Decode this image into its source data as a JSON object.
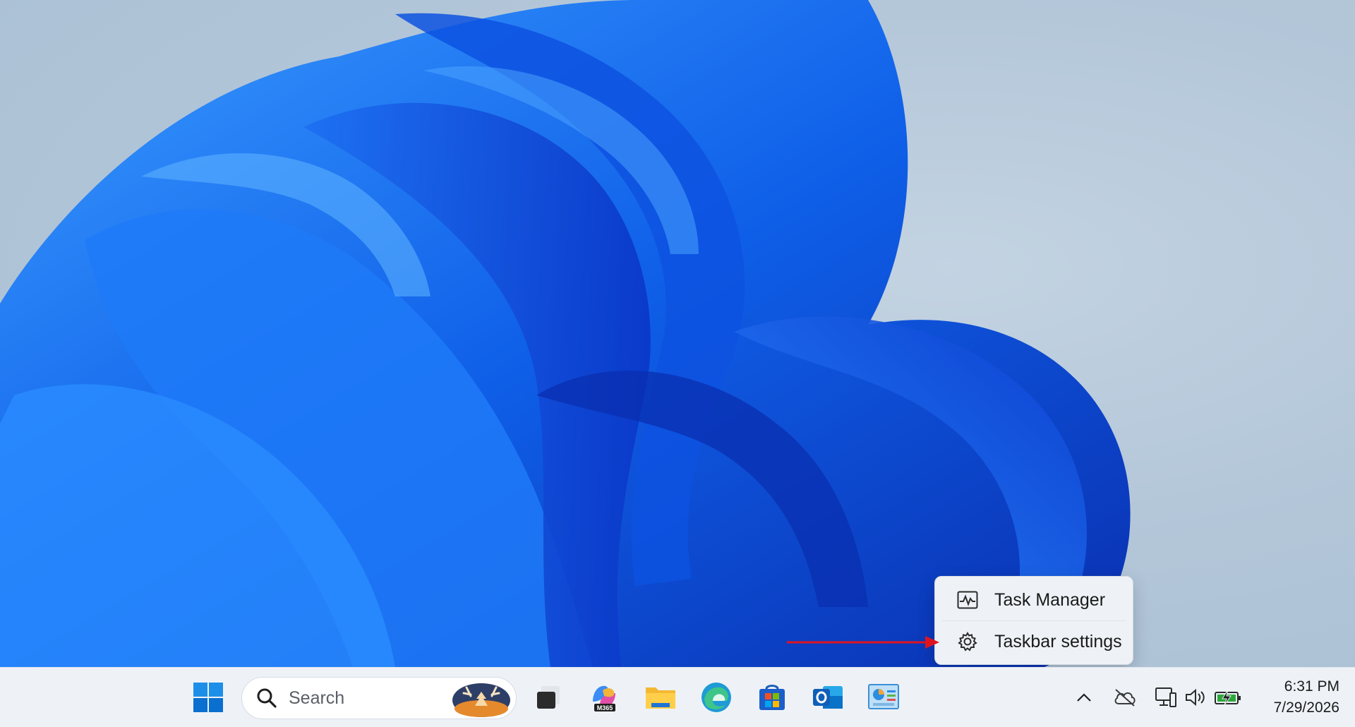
{
  "context_menu": {
    "items": [
      {
        "label": "Task Manager",
        "icon": "task-manager-icon"
      },
      {
        "label": "Taskbar settings",
        "icon": "gear-icon"
      }
    ]
  },
  "taskbar": {
    "search_placeholder": "Search",
    "apps": [
      {
        "name": "start-button",
        "icon": "windows-logo-icon"
      },
      {
        "name": "task-view-button",
        "icon": "task-view-icon"
      },
      {
        "name": "m365-copilot-app",
        "icon": "m365-icon",
        "badge": "M365"
      },
      {
        "name": "file-explorer-app",
        "icon": "folder-icon"
      },
      {
        "name": "edge-app",
        "icon": "edge-icon"
      },
      {
        "name": "microsoft-store-app",
        "icon": "store-icon"
      },
      {
        "name": "outlook-app",
        "icon": "outlook-icon"
      },
      {
        "name": "control-panel-app",
        "icon": "control-panel-icon"
      }
    ],
    "tray": [
      "chevron-up-icon",
      "onedrive-offline-icon",
      "network-icon",
      "volume-icon",
      "battery-charging-icon"
    ],
    "clock": {
      "time": "6:31 PM",
      "date": "7/29/2026"
    }
  },
  "colors": {
    "accent": "#0067c0",
    "annotation_arrow": "#e0141e",
    "battery_green": "#2ca83a"
  }
}
